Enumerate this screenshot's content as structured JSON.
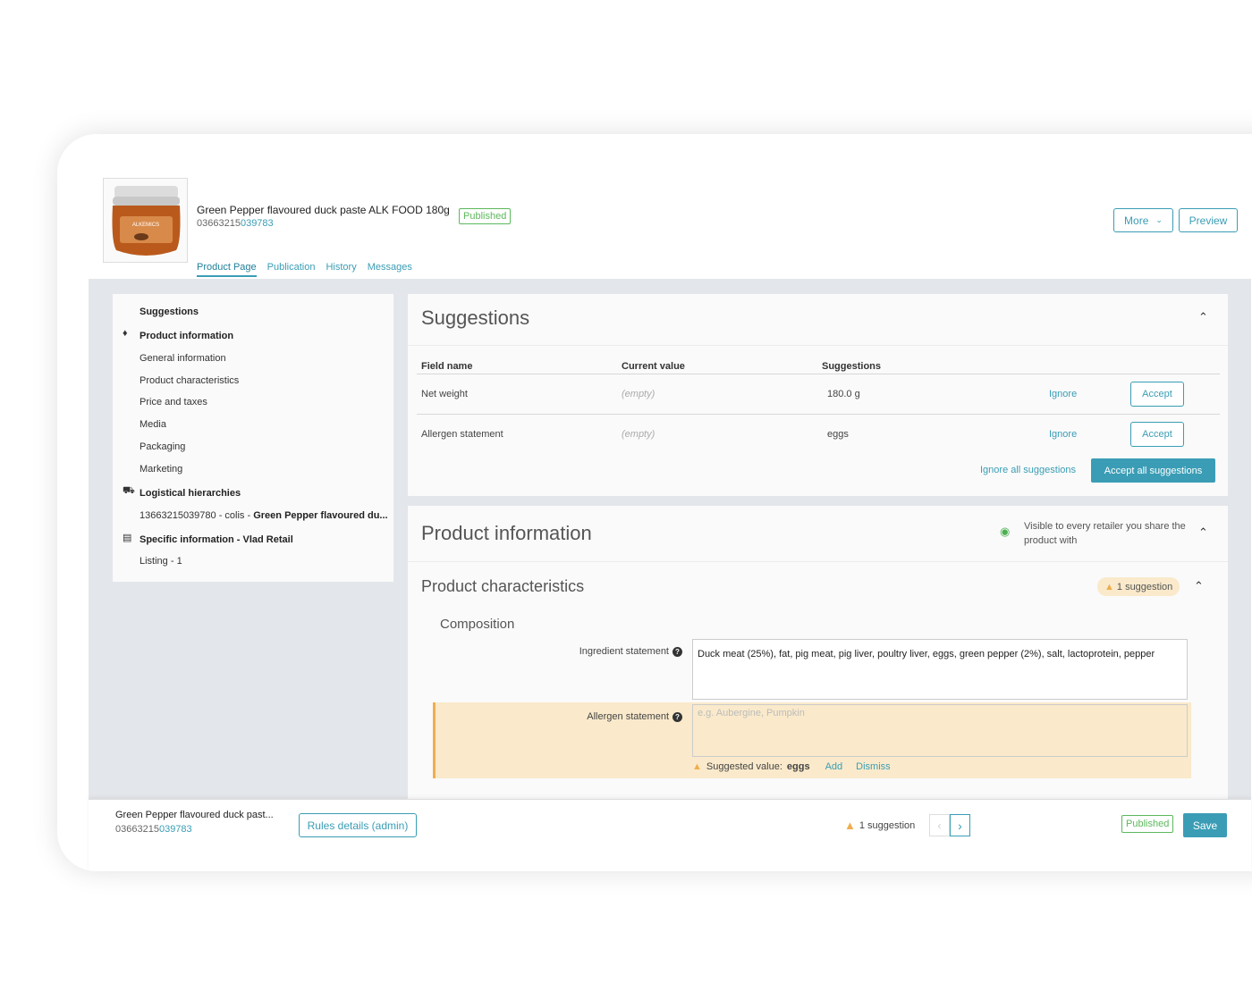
{
  "product": {
    "title": "Green Pepper flavoured duck paste ALK FOOD 180g",
    "gtin_prefix": "03663215",
    "gtin_suffix": "039783",
    "status": "Published",
    "jar_label": "ALKEMICS"
  },
  "header": {
    "more_label": "More",
    "preview_label": "Preview",
    "tabs": [
      "Product Page",
      "Publication",
      "History",
      "Messages"
    ]
  },
  "sidebar": {
    "items": [
      {
        "label": "Suggestions"
      },
      {
        "label": "Product information"
      },
      {
        "label": "General information"
      },
      {
        "label": "Product characteristics"
      },
      {
        "label": "Price and taxes"
      },
      {
        "label": "Media"
      },
      {
        "label": "Packaging"
      },
      {
        "label": "Marketing"
      },
      {
        "label": "Logistical hierarchies"
      },
      {
        "label": "13663215039780 - colis -",
        "extra": "Green Pepper flavoured du..."
      },
      {
        "label": "Specific information - Vlad Retail"
      },
      {
        "label": "Listing - 1"
      }
    ]
  },
  "suggestions": {
    "title": "Suggestions",
    "columns": [
      "Field name",
      "Current value",
      "Suggestions"
    ],
    "rows": [
      {
        "field": "Net weight",
        "current": "(empty)",
        "suggestion": "180.0 g",
        "ignore": "Ignore",
        "accept": "Accept"
      },
      {
        "field": "Allergen statement",
        "current": "(empty)",
        "suggestion": "eggs",
        "ignore": "Ignore",
        "accept": "Accept"
      }
    ],
    "ignore_all": "Ignore all suggestions",
    "accept_all": "Accept all suggestions"
  },
  "product_info": {
    "title": "Product information",
    "visibility": "Visible to every retailer you share the product with",
    "section_title": "Product characteristics",
    "suggestion_badge": "1 suggestion",
    "subsection": "Composition",
    "ingredient_label": "Ingredient statement",
    "ingredient_value": "Duck meat (25%), fat, pig meat, pig liver, poultry liver, eggs, green pepper (2%), salt, lactoprotein, pepper",
    "allergen_label": "Allergen statement",
    "allergen_placeholder": "e.g. Aubergine, Pumpkin",
    "suggested_prefix": "Suggested value:",
    "suggested_value": "eggs",
    "add_label": "Add",
    "dismiss_label": "Dismiss"
  },
  "footer": {
    "title": "Green Pepper flavoured duck past...",
    "gtin_prefix": "03663215",
    "gtin_suffix": "039783",
    "rules_label": "Rules details (admin)",
    "suggestion_count": "1 suggestion",
    "status": "Published",
    "save_label": "Save"
  },
  "colors": {
    "accent": "#3a9db5",
    "published": "#5cb85c",
    "warning": "#f0ad4e",
    "highlight": "#faeacb"
  }
}
